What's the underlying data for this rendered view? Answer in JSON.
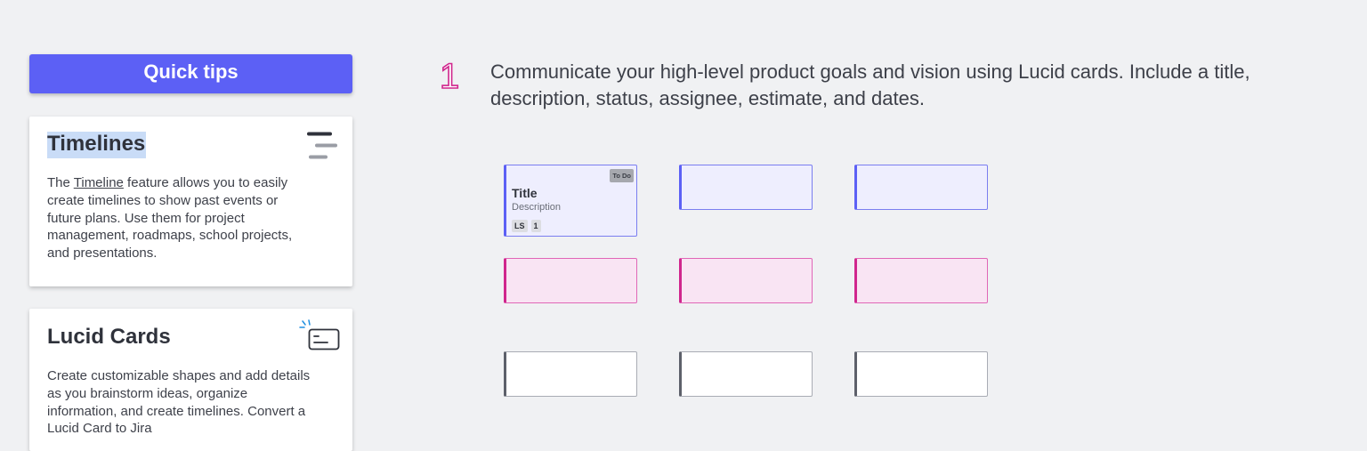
{
  "sidebar": {
    "header": "Quick tips",
    "cards": [
      {
        "title": "Timelines",
        "icon": "timeline-icon",
        "body_before": "The ",
        "link": "Timeline",
        "body_after": " feature allows you to easily create timelines to show past events or future plans. Use them for project management, roadmaps, school projects, and presentations."
      },
      {
        "title": "Lucid Cards",
        "icon": "lucid-card-icon",
        "body": "Create customizable shapes and add details as you brainstorm ideas, organize information, and create timelines. Convert a Lucid Card to Jira"
      }
    ]
  },
  "instruction": {
    "step": "1",
    "text": "Communicate your high-level product goals and vision using Lucid cards. Include a title, description, status, assignee, estimate, and dates."
  },
  "board": {
    "sample_card": {
      "title": "Title",
      "description": "Description",
      "status": "To Do",
      "assignee": "LS",
      "estimate": "1"
    },
    "colors": {
      "purple": "#5c60f5",
      "pink": "#d0268d",
      "gray": "#5d606a"
    },
    "rows": [
      "purple",
      "pink",
      "gray"
    ]
  }
}
